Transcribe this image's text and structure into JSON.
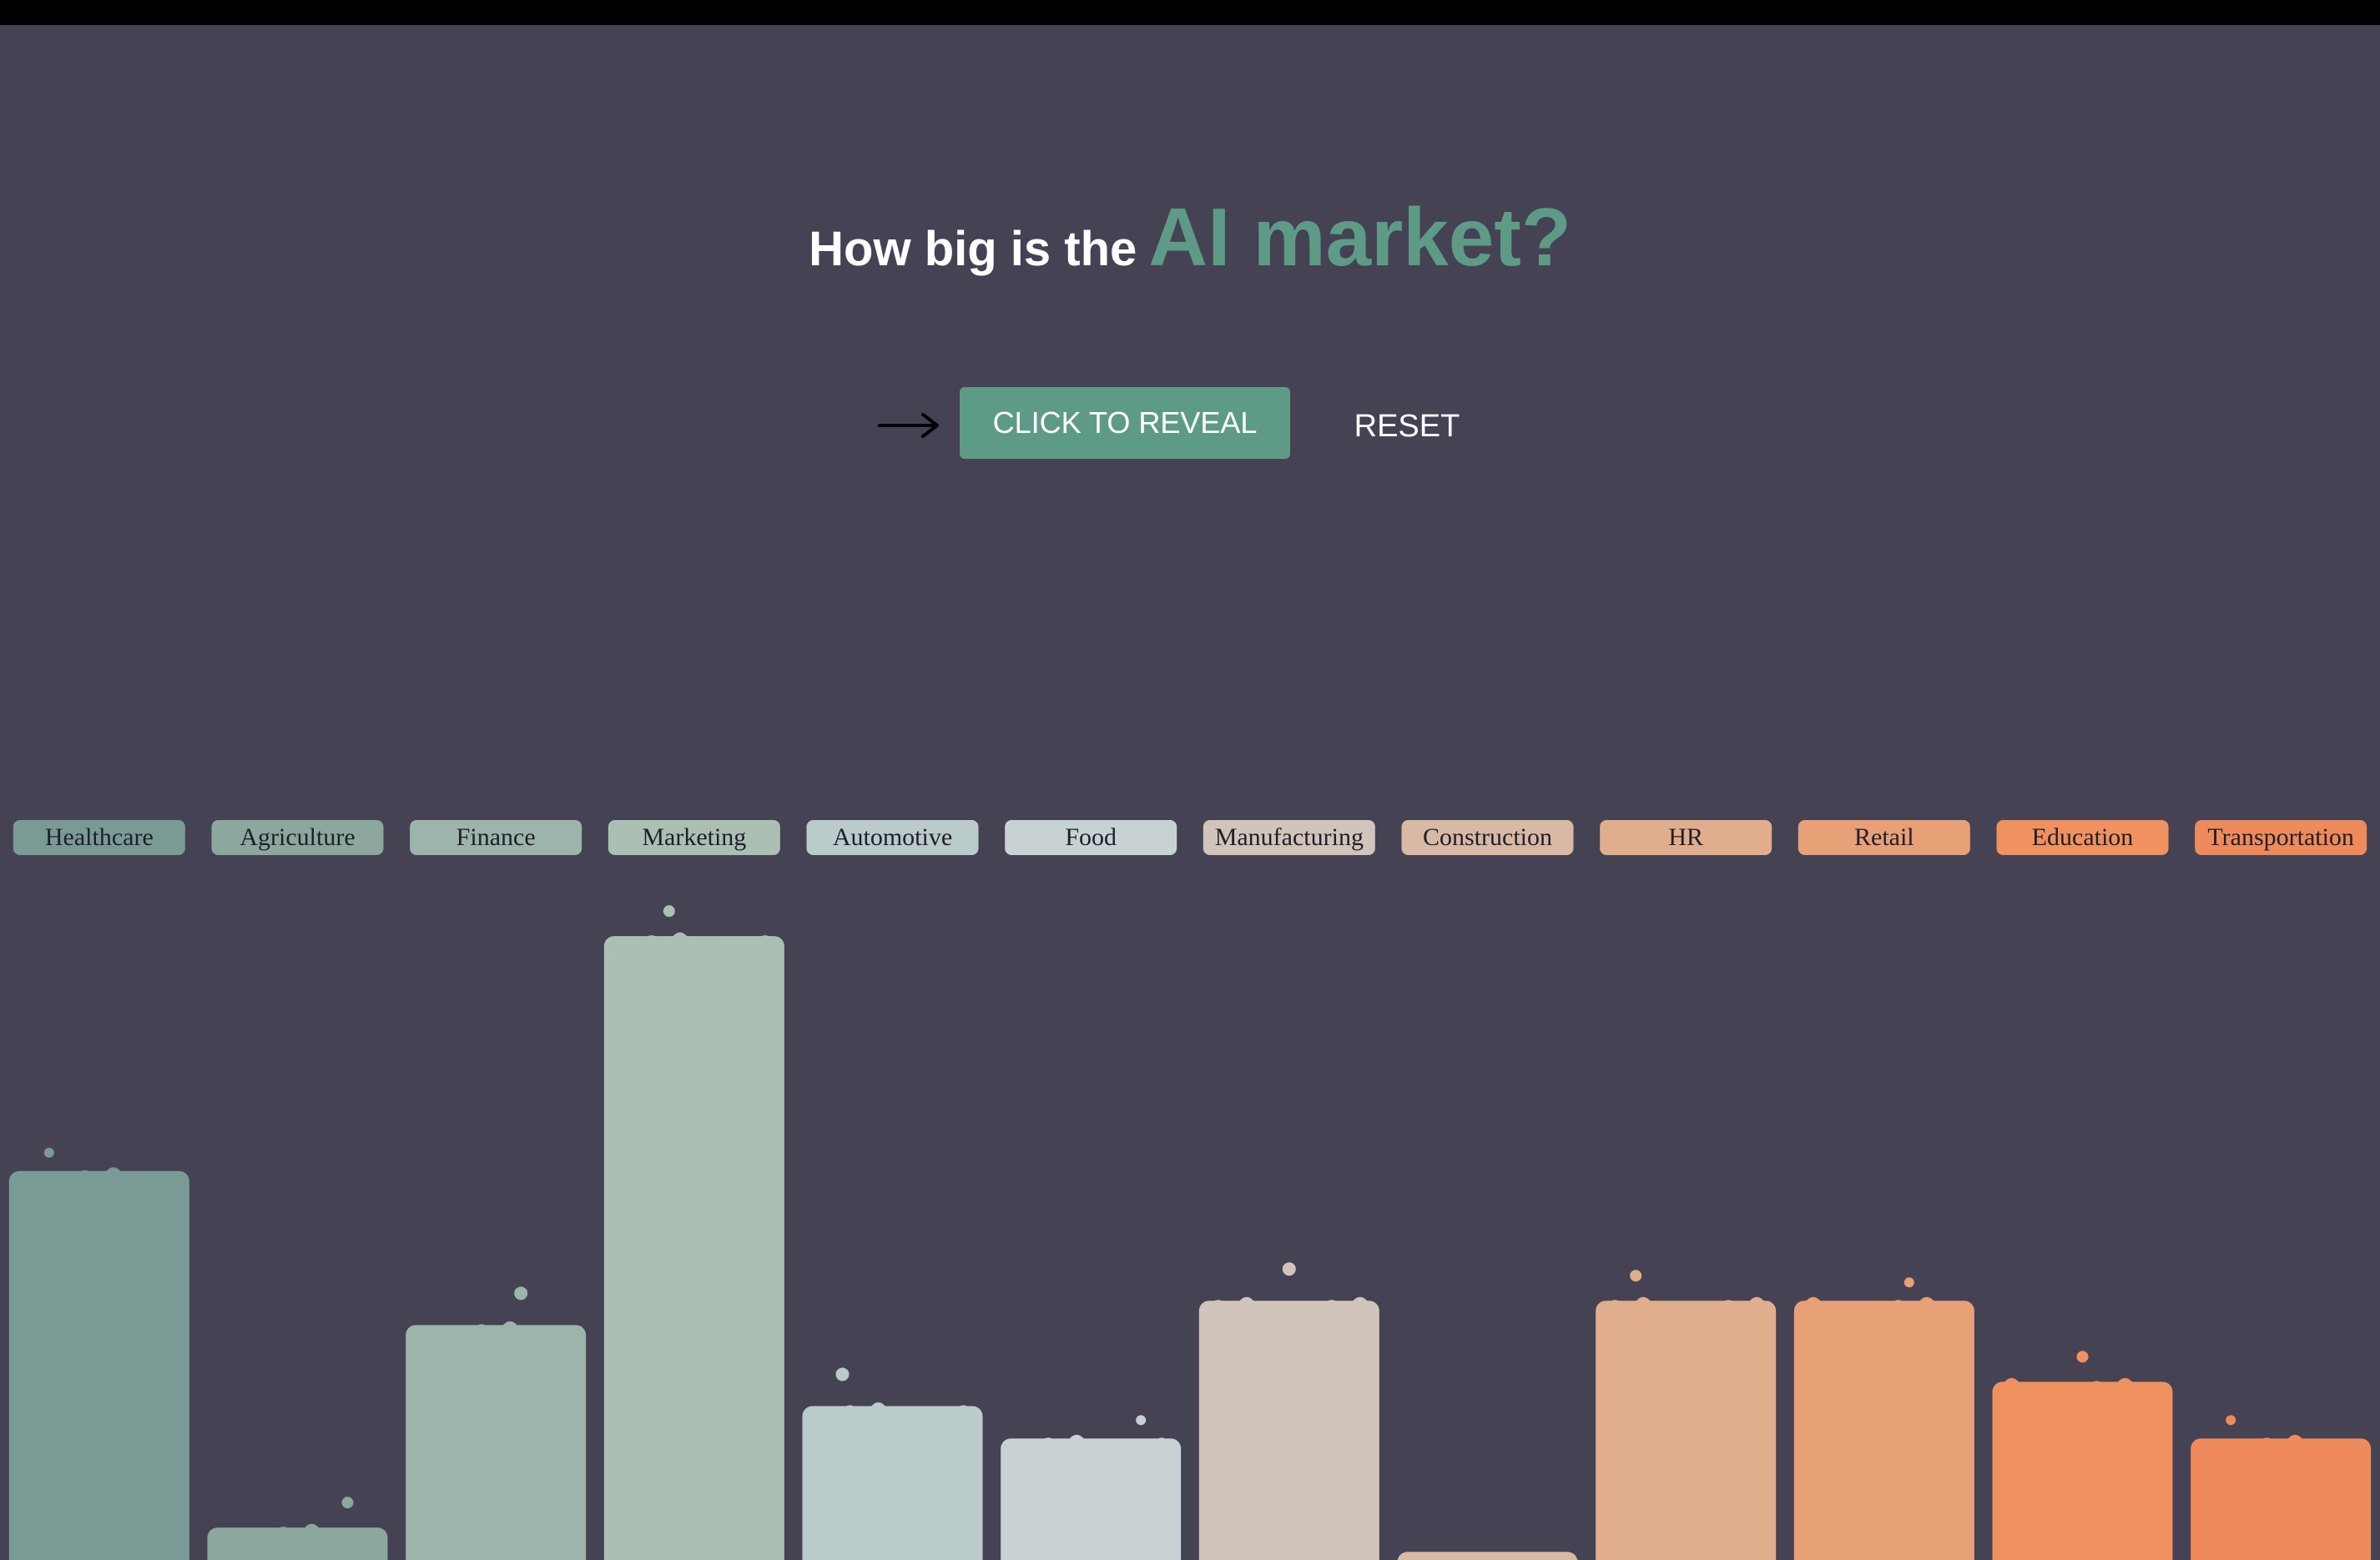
{
  "header": {
    "title_lead": "How big is the",
    "title_accent": "AI market?"
  },
  "controls": {
    "arrow_icon": "right-arrow-icon",
    "reveal_label": "CLICK TO REVEAL",
    "reset_label": "RESET"
  },
  "colors": {
    "background": "#454254",
    "accent": "#5e9b86",
    "text": "#ffffff"
  },
  "chart_data": {
    "type": "bar",
    "title": "",
    "xlabel": "",
    "ylabel": "",
    "values_hidden": true,
    "categories": [
      "Healthcare",
      "Agriculture",
      "Finance",
      "Marketing",
      "Automotive",
      "Food",
      "Manufacturing",
      "Construction",
      "HR",
      "Retail",
      "Education",
      "Transportation"
    ],
    "values": [
      48,
      4,
      29,
      77,
      19,
      15,
      32,
      1,
      32,
      32,
      22,
      15
    ],
    "ylim": [
      0,
      80
    ],
    "colors": [
      "#7a9a95",
      "#8ca79e",
      "#9cb4aa",
      "#abbfb3",
      "#bbcaca",
      "#c8d1d3",
      "#d1c4ba",
      "#d7b9a4",
      "#e0ae8c",
      "#e8a077",
      "#ef925f",
      "#ee8a5b"
    ]
  }
}
